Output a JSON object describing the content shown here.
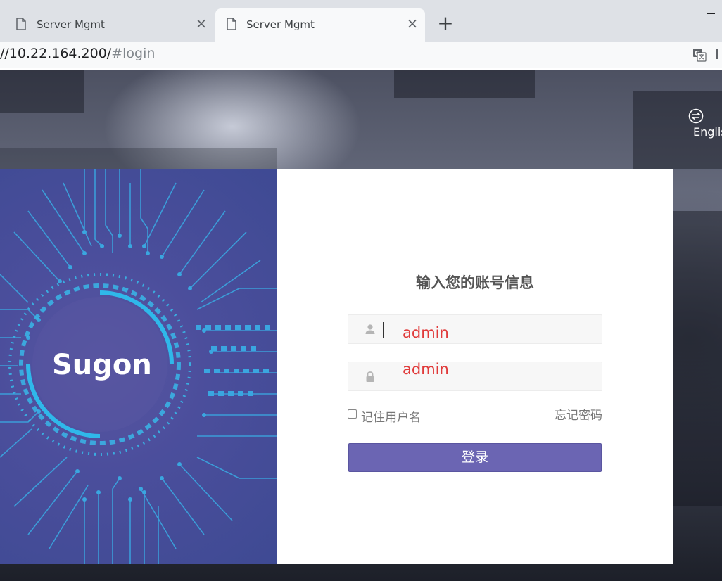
{
  "browser": {
    "tabs": [
      {
        "title": "Server Mgmt",
        "active": false
      },
      {
        "title": "Server Mgmt",
        "active": true
      }
    ],
    "new_tab_label": "+",
    "close_glyph": "×",
    "address": {
      "host": "//10.22.164.200/",
      "path": "#login"
    },
    "icons": [
      "document-icon",
      "close-icon",
      "plus-icon",
      "translate-icon",
      "minimize-icon"
    ]
  },
  "page": {
    "language_switch": {
      "label": "Englis",
      "icon": "swap-arrows-icon"
    },
    "brand": {
      "name": "Sugon"
    },
    "login": {
      "title": "输入您的账号信息",
      "username_value": "admin",
      "password_value": "admin",
      "remember_label": "记住用户名",
      "forgot_label": "忘记密码",
      "submit_label": "登录"
    },
    "colors": {
      "button": "#6b65b3",
      "entry_text": "#e03a3a",
      "left_panel": "#4b4e9c",
      "circuit": "#38b6e8"
    }
  }
}
